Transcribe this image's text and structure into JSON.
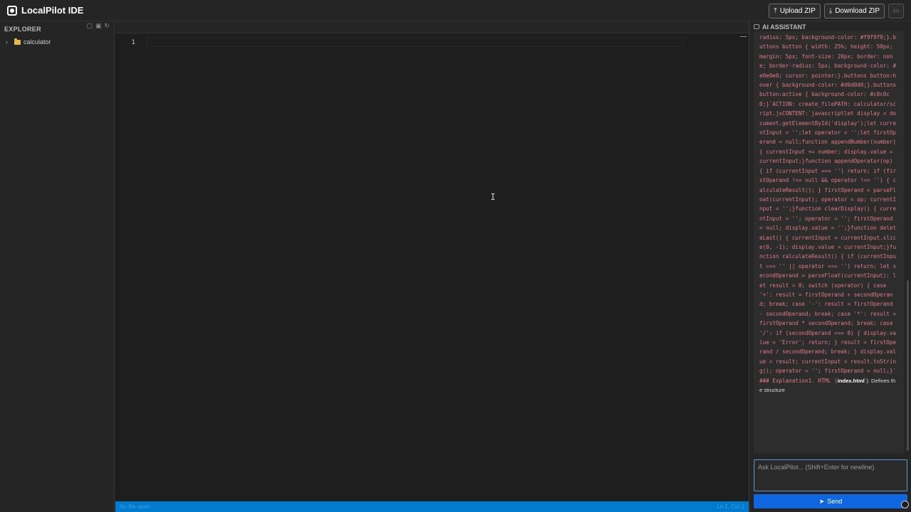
{
  "app": {
    "title": "LocalPilot IDE"
  },
  "toolbar": {
    "upload_label": "Upload ZIP",
    "download_label": "Download ZIP"
  },
  "explorer": {
    "title": "EXPLORER",
    "items": [
      {
        "label": "calculator",
        "type": "folder",
        "expanded": false
      }
    ]
  },
  "editor": {
    "line_number": "1",
    "status_left": "No file open",
    "status_right": "Ln 1, Col 1"
  },
  "assistant": {
    "title": "AI ASSISTANT",
    "message_code": "radius: 5px; background-color: #f9f9f9;}.buttons button { width: 25%; height: 50px; margin: 5px; font-size: 20px; border: none; border-radius: 5px; background-color: #e0e0e0; cursor: pointer;}.buttons button:hover { background-color: #d0d0d0;}.buttons button:active { background-color: #c0c0c0;}`ACTION: create_filePATH: calculator/script.jsCONTENT:`javascriptlet display = document.getElementById('display');let currentInput = '';let operator = '';let firstOperand = null;function appendNumber(number) { currentInput += number; display.value = currentInput;}function appendOperator(op) { if (currentInput === '') return; if (firstOperand !== null && operator !== '') { calculateResult(); } firstOperand = parseFloat(currentInput); operator = op; currentInput = '';}function clearDisplay() { currentInput = ''; operator = ''; firstOperand = null; display.value = '';}function deleteLast() { currentInput = currentInput.slice(0, -1); display.value = currentInput;}function calculateResult() { if (currentInput === '' || operator === '') return; let secondOperand = parseFloat(currentInput); let result = 0; switch (operator) { case '+': result = firstOperand + secondOperand; break; case '-': result = firstOperand - secondOperand; break; case '*': result = firstOperand * secondOperand; break; case '/': if (secondOperand === 0) { display.value = 'Error'; return; } result = firstOperand / secondOperand; break; } display.value = result; currentInput = result.toString(); operator = ''; firstOperand = null;}`### Explanation1. HTML (",
    "message_bold": "index.html",
    "message_tail": "`): Defines the structure",
    "input_placeholder": "Ask LocalPilot... (Shift+Enter for newline)",
    "send_label": "Send"
  },
  "colors": {
    "accent": "#007acc",
    "send_button": "#0e66e0",
    "code_text": "#e07a86",
    "folder": "#e8b84a"
  }
}
